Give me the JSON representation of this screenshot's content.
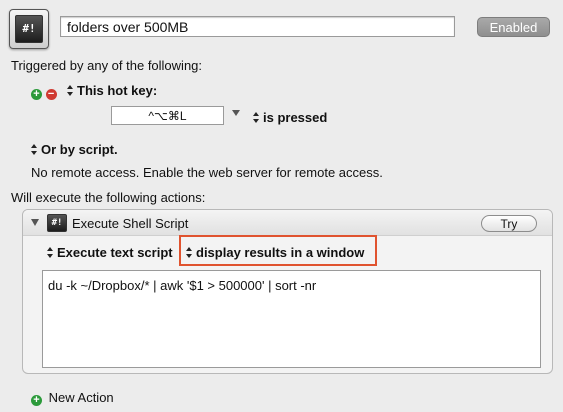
{
  "macro": {
    "icon_label": "#!",
    "name": "folders over 500MB",
    "enabled_label": "Enabled"
  },
  "triggers": {
    "heading": "Triggered by any of the following:",
    "add_symbol": "+",
    "remove_symbol": "−",
    "hotkey_label": "This hot key:",
    "hotkey_value": "^⌥⌘L",
    "pressed_label": "is pressed",
    "script_label": "Or by script.",
    "remote_text": "No remote access.  Enable the web server for remote access."
  },
  "actions": {
    "heading": "Will execute the following actions:",
    "action_icon_label": "#!",
    "action_title": "Execute Shell Script",
    "try_label": "Try",
    "mode_label": "Execute text script",
    "output_label": "display results in a window",
    "script_text": "du -k ~/Dropbox/* | awk '$1 > 500000' | sort -nr",
    "new_action_label": "New Action"
  },
  "colors": {
    "highlight": "#e0532f",
    "add_green": "#2b9a3a",
    "remove_red": "#d03a32"
  }
}
